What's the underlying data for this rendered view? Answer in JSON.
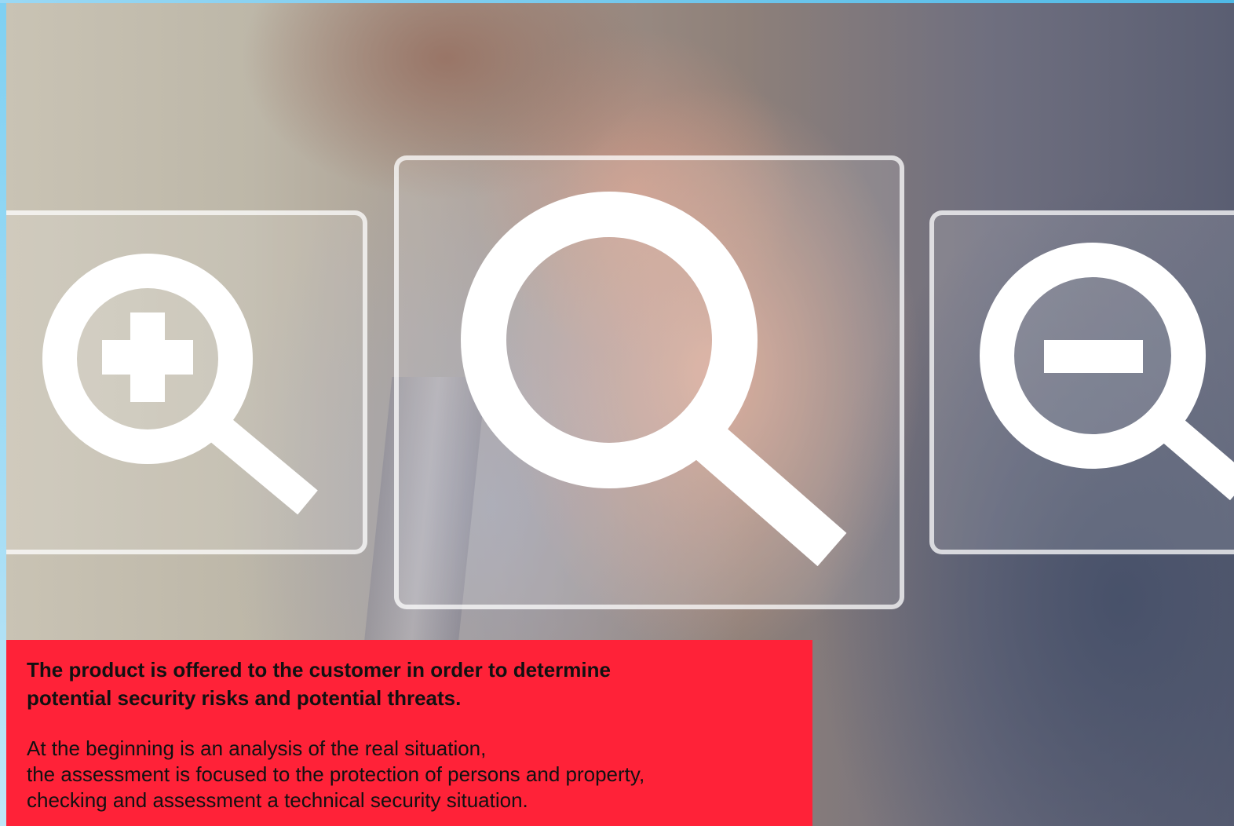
{
  "banner": {
    "image_description_icons": [
      "zoom-in-icon",
      "search-icon",
      "zoom-out-icon"
    ]
  },
  "info": {
    "headline_lines": [
      "The product is offered to the customer in order to determine",
      "potential security risks and potential threats."
    ],
    "body_lines": [
      "At the beginning is an analysis of the real situation,",
      "the assessment is focused to the protection of persons and property,",
      "checking and assessment a technical security situation."
    ]
  },
  "colors": {
    "info_box": "#ff2238",
    "text": "#111111",
    "frame": "#7fd0f2"
  }
}
